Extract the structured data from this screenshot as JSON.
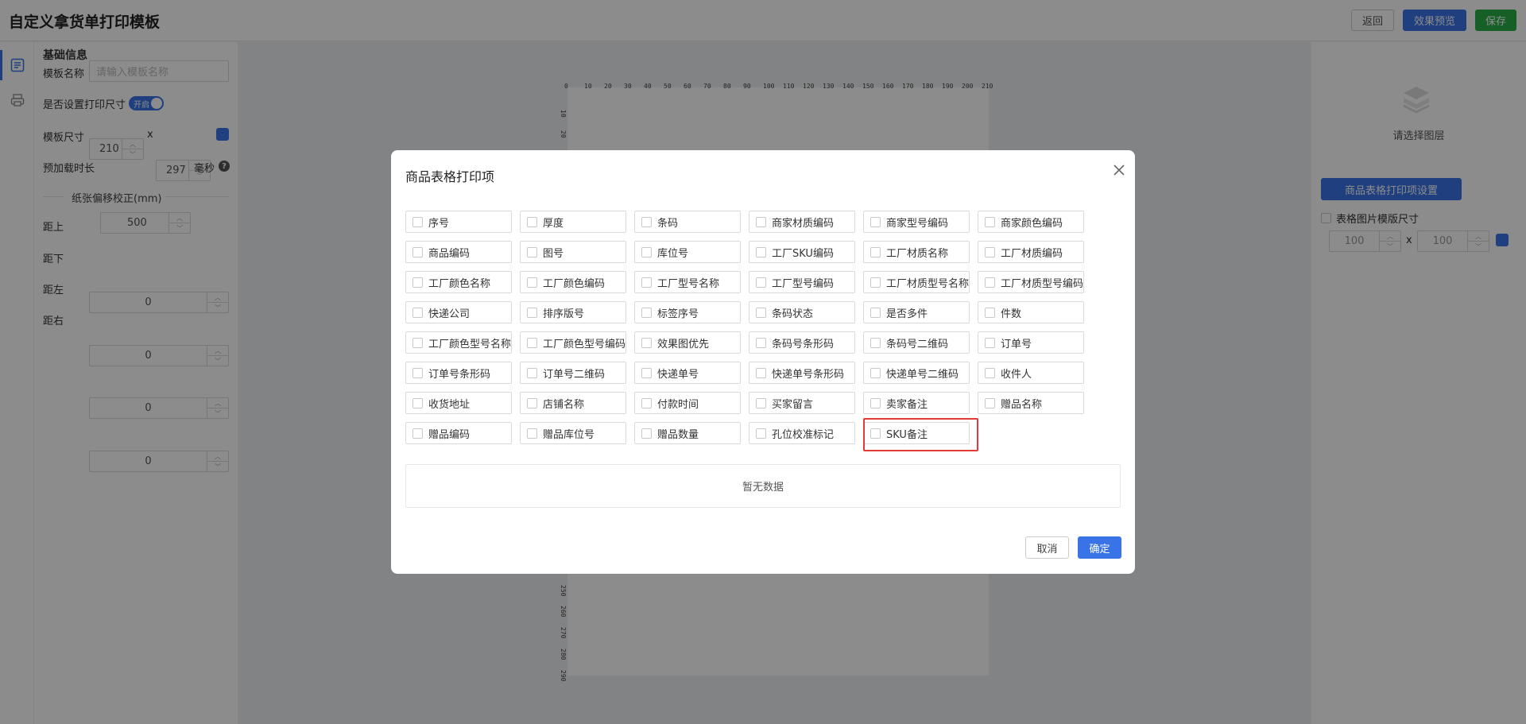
{
  "header": {
    "title": "自定义拿货单打印模板",
    "back_label": "返回",
    "preview_label": "效果预览",
    "save_label": "保存"
  },
  "left_panel": {
    "section_title": "基础信息",
    "template_name_label": "模板名称",
    "template_name_placeholder": "请输入模板名称",
    "print_size_label": "是否设置打印尺寸",
    "print_size_toggle": "开启",
    "template_size_label": "模板尺寸",
    "width": "210",
    "times": "x",
    "height": "297",
    "preload_label": "预加载时长",
    "preload_value": "500",
    "preload_unit": "毫秒",
    "help": "?",
    "offset_title": "纸张偏移校正(mm)",
    "offsets": [
      {
        "label": "距上",
        "value": "0"
      },
      {
        "label": "距下",
        "value": "0"
      },
      {
        "label": "距左",
        "value": "0"
      },
      {
        "label": "距右",
        "value": "0"
      }
    ]
  },
  "ruler": {
    "top_ticks": [
      "0",
      "10",
      "20",
      "30",
      "40",
      "50",
      "60",
      "70",
      "80",
      "90",
      "100",
      "110",
      "120",
      "130",
      "140",
      "150",
      "160",
      "170",
      "180",
      "190",
      "200",
      "210"
    ],
    "left_ticks": [
      "10",
      "20",
      "250",
      "260",
      "270",
      "280",
      "290"
    ]
  },
  "right_panel": {
    "layer_hint": "请选择图层",
    "table_settings_label": "商品表格打印项设置",
    "image_size_label": "表格图片模版尺寸",
    "img_w": "100",
    "times": "x",
    "img_h": "100"
  },
  "modal": {
    "title": "商品表格打印项",
    "options": [
      "序号",
      "厚度",
      "条码",
      "商家材质编码",
      "商家型号编码",
      "商家颜色编码",
      "商品编码",
      "图号",
      "库位号",
      "工厂SKU编码",
      "工厂材质名称",
      "工厂材质编码",
      "工厂颜色名称",
      "工厂颜色编码",
      "工厂型号名称",
      "工厂型号编码",
      "工厂材质型号名称",
      "工厂材质型号编码",
      "快递公司",
      "排序版号",
      "标签序号",
      "条码状态",
      "是否多件",
      "件数",
      "工厂颜色型号名称",
      "工厂颜色型号编码",
      "效果图优先",
      "条码号条形码",
      "条码号二维码",
      "订单号",
      "订单号条形码",
      "订单号二维码",
      "快递单号",
      "快递单号条形码",
      "快递单号二维码",
      "收件人",
      "收货地址",
      "店铺名称",
      "付款时间",
      "买家留言",
      "卖家备注",
      "赠品名称",
      "赠品编码",
      "赠品库位号",
      "赠品数量",
      "孔位校准标记",
      "SKU备注"
    ],
    "no_data": "暂无数据",
    "cancel_label": "取消",
    "ok_label": "确定"
  }
}
